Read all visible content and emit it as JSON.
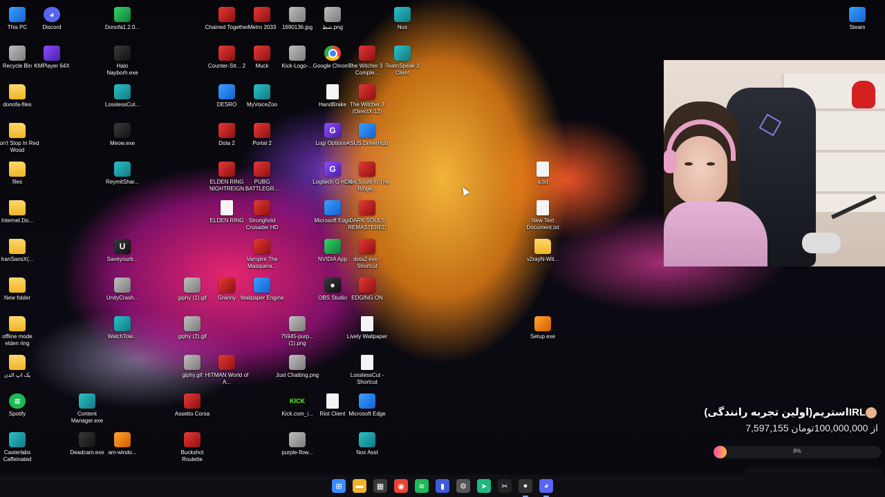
{
  "desktop_icons": [
    {
      "label": "This PC",
      "icon": "computer-icon"
    },
    {
      "label": "Discord",
      "icon": "discord-icon"
    },
    {
      "label": "Donofa1.2.0...",
      "icon": "paper-plane-icon"
    },
    {
      "label": "Chained Together",
      "icon": "game-icon"
    },
    {
      "label": "Metro 2033",
      "icon": "game-icon"
    },
    {
      "label": "1690136.jpg",
      "icon": "image-file-icon"
    },
    {
      "label": "شط.png",
      "icon": "image-file-icon"
    },
    {
      "label": "Nox",
      "icon": "nox-icon"
    },
    {
      "label": "Steam",
      "icon": "steam-icon"
    },
    {
      "label": "Recycle Bin",
      "icon": "recycle-bin-icon"
    },
    {
      "label": "KMPlayer 64X",
      "icon": "media-player-icon"
    },
    {
      "label": "Halo Nayborh.exe",
      "icon": "exe-icon"
    },
    {
      "label": "Counter-Str... 2",
      "icon": "game-icon"
    },
    {
      "label": "Muck",
      "icon": "game-icon"
    },
    {
      "label": "Kick-Logo-...",
      "icon": "image-file-icon"
    },
    {
      "label": "Google Chrome",
      "icon": "chrome-icon"
    },
    {
      "label": "The Witcher 3 - Comple...",
      "icon": "game-icon"
    },
    {
      "label": "TeamSpeak 3 Client",
      "icon": "teamspeak-icon"
    },
    {
      "label": "donofa-files",
      "icon": "folder-icon"
    },
    {
      "label": "LosslessCut...",
      "icon": "app-icon"
    },
    {
      "label": "DESRO",
      "icon": "edge-icon"
    },
    {
      "label": "MyVoiceZoo",
      "icon": "app-icon"
    },
    {
      "label": "HandBrake",
      "icon": "file-icon"
    },
    {
      "label": "The Witcher 3 (DirectX 12)",
      "icon": "game-icon"
    },
    {
      "label": "Don't Stop In Red Wood",
      "icon": "folder-icon"
    },
    {
      "label": "Meow.exe",
      "icon": "exe-icon"
    },
    {
      "label": "Dota 2",
      "icon": "game-icon"
    },
    {
      "label": "Portal 2",
      "icon": "game-icon"
    },
    {
      "label": "Logi Options+",
      "icon": "logi-icon"
    },
    {
      "label": "ASUS DriverHub",
      "icon": "gear-icon"
    },
    {
      "label": "files",
      "icon": "folder-icon"
    },
    {
      "label": "ReymitShar...",
      "icon": "app-icon"
    },
    {
      "label": "ELDEN RING NIGHTREIGN",
      "icon": "game-icon"
    },
    {
      "label": "PUBG BATTLEGR...",
      "icon": "game-icon"
    },
    {
      "label": "Logitech G HUB",
      "icon": "logi-icon"
    },
    {
      "label": "Dark Souls III The Ringe...",
      "icon": "game-icon"
    },
    {
      "label": "a.txt",
      "icon": "text-file-icon"
    },
    {
      "label": "Internet.Do...",
      "icon": "folder-icon"
    },
    {
      "label": "ELDEN RING",
      "icon": "file-icon"
    },
    {
      "label": "Stronghold Crusader HD",
      "icon": "game-icon"
    },
    {
      "label": "Microsoft Edge",
      "icon": "edge-icon"
    },
    {
      "label": "DARK SOULS REMASTERED",
      "icon": "game-icon"
    },
    {
      "label": "New Text Document.txt",
      "icon": "text-file-icon"
    },
    {
      "label": "IranSansX(...",
      "icon": "folder-icon"
    },
    {
      "label": "Saveyourb...",
      "icon": "unreal-icon"
    },
    {
      "label": "Vampire The Masquera...",
      "icon": "game-icon"
    },
    {
      "label": "NVIDIA App",
      "icon": "nvidia-icon"
    },
    {
      "label": "dota2.exe - Shortcut",
      "icon": "game-icon"
    },
    {
      "label": "v2rayN-Wit...",
      "icon": "folder-icon"
    },
    {
      "label": "New folder",
      "icon": "folder-icon"
    },
    {
      "label": "UnityCrash...",
      "icon": "unity-icon"
    },
    {
      "label": "giphy (1).gif",
      "icon": "image-file-icon"
    },
    {
      "label": "Granny",
      "icon": "game-icon"
    },
    {
      "label": "Wallpaper Engine",
      "icon": "wallpaper-engine-icon"
    },
    {
      "label": "OBS Studio",
      "icon": "obs-icon"
    },
    {
      "label": "EDGING ON",
      "icon": "game-icon"
    },
    {
      "label": "offline mode elden ring",
      "icon": "folder-icon"
    },
    {
      "label": "WatchTow...",
      "icon": "app-icon"
    },
    {
      "label": "giphy (2).gif",
      "icon": "image-file-icon"
    },
    {
      "label": "75945-purp... (1).png",
      "icon": "image-file-icon"
    },
    {
      "label": "Lively Wallpaper",
      "icon": "file-icon"
    },
    {
      "label": "Setup.exe",
      "icon": "installer-icon"
    },
    {
      "label": "یک اپ الدن",
      "icon": "folder-icon"
    },
    {
      "label": "giphy.gif",
      "icon": "image-file-icon"
    },
    {
      "label": "HITMAN World of A...",
      "icon": "game-icon"
    },
    {
      "label": "Just Chatting.png",
      "icon": "image-file-icon"
    },
    {
      "label": "LosslessCut - Shortcut",
      "icon": "file-icon"
    },
    {
      "label": "Spotify",
      "icon": "spotify-icon"
    },
    {
      "label": "Content Manager.exe",
      "icon": "app-icon"
    },
    {
      "label": "Assetto Corsa",
      "icon": "game-icon"
    },
    {
      "label": "Kick.com_i...",
      "icon": "kick-icon"
    },
    {
      "label": "Riot Client",
      "icon": "file-icon"
    },
    {
      "label": "Microsoft Edge",
      "icon": "edge-icon"
    },
    {
      "label": "Casterlabs Caffeinated",
      "icon": "app-icon"
    },
    {
      "label": "Deadcam.exe",
      "icon": "exe-icon"
    },
    {
      "label": "am-windo...",
      "icon": "archive-icon"
    },
    {
      "label": "Buckshot Roulette",
      "icon": "game-icon"
    },
    {
      "label": "purple-flow...",
      "icon": "image-file-icon"
    },
    {
      "label": "Nox Asst",
      "icon": "nox-icon"
    }
  ],
  "donation": {
    "title": "IRLاستریم(اولین تجربه رانندگی)",
    "amount": "7,597,155 از 100,000,000تومان",
    "progress_label": "8%",
    "progress": 0.08
  },
  "taskbar": [
    {
      "name": "start-button",
      "icon": "windows-start-icon",
      "glyph": "⊞",
      "color": "#3b8cff"
    },
    {
      "name": "file-explorer",
      "icon": "folder-icon",
      "glyph": "▬",
      "color": "#f0b429"
    },
    {
      "name": "store",
      "icon": "store-icon",
      "glyph": "▦",
      "color": "#3a3a3a"
    },
    {
      "name": "chrome",
      "icon": "chrome-icon",
      "glyph": "◉",
      "color": "#ea4335"
    },
    {
      "name": "spotify",
      "icon": "spotify-icon",
      "glyph": "≋",
      "color": "#1db954"
    },
    {
      "name": "stats",
      "icon": "chart-icon",
      "glyph": "▮",
      "color": "#3b5bdb"
    },
    {
      "name": "settings",
      "icon": "gear-icon",
      "glyph": "⚙",
      "color": "#555"
    },
    {
      "name": "donofa",
      "icon": "paper-plane-icon",
      "glyph": "➤",
      "color": "#1eb980"
    },
    {
      "name": "capcut",
      "icon": "capcut-icon",
      "glyph": "✂",
      "color": "#222"
    },
    {
      "name": "obs",
      "icon": "obs-icon",
      "glyph": "●",
      "color": "#333"
    },
    {
      "name": "discord",
      "icon": "discord-icon",
      "glyph": "◕",
      "color": "#5865f2"
    }
  ]
}
